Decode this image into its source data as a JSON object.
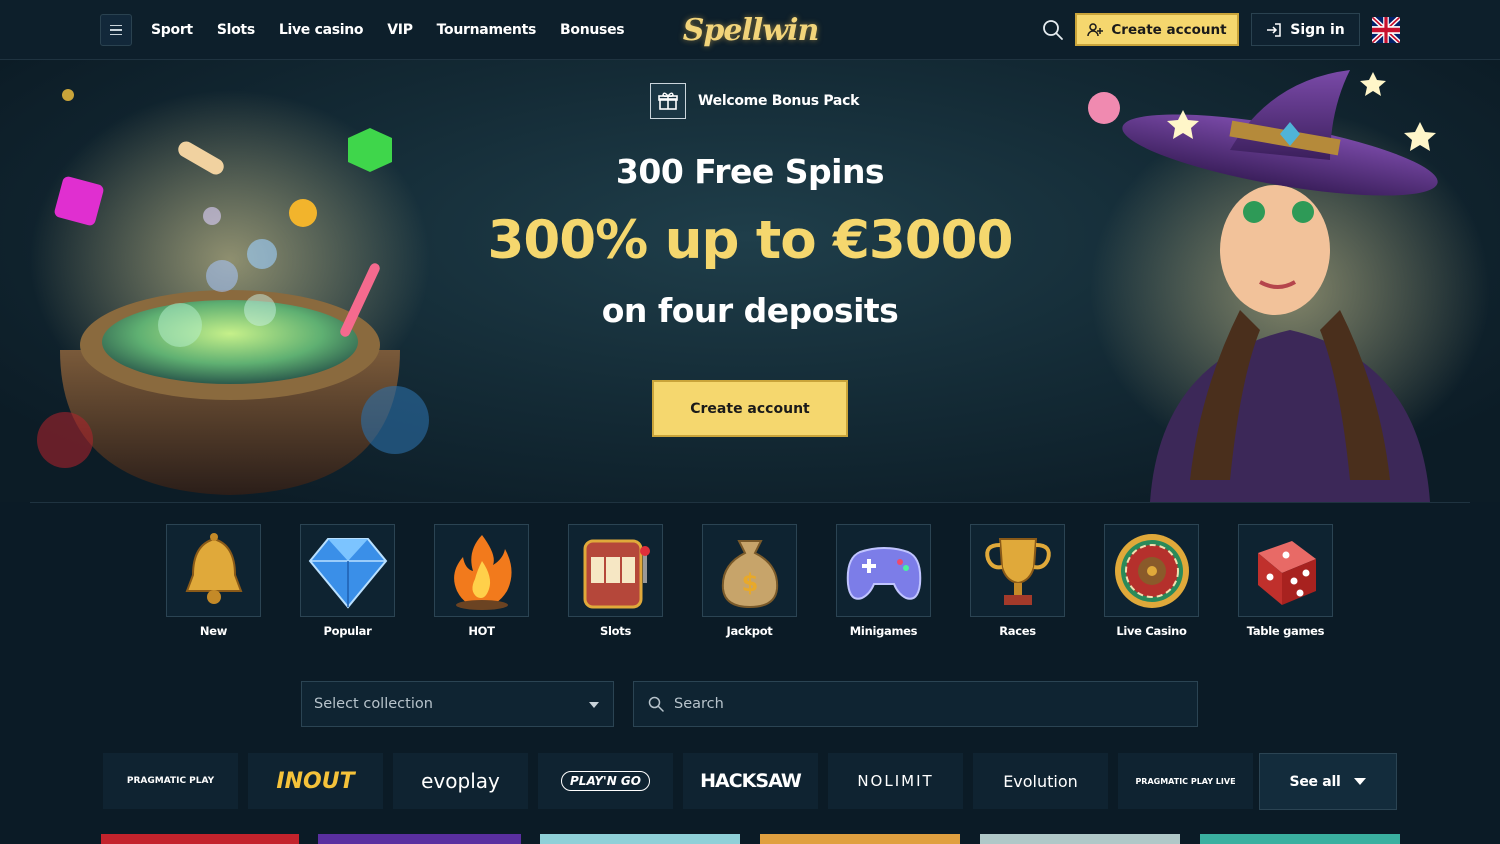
{
  "header": {
    "nav": [
      "Sport",
      "Slots",
      "Live casino",
      "VIP",
      "Tournaments",
      "Bonuses"
    ],
    "logo_text": "Spellwin",
    "create_account_label": "Create account",
    "sign_in_label": "Sign in",
    "language": "en-GB",
    "icons": {
      "menu": "hamburger-menu-icon",
      "search": "search-icon",
      "create": "add-user-icon",
      "signin": "sign-in-icon",
      "flag": "uk-flag-icon"
    }
  },
  "hero": {
    "bonus_label": "Welcome Bonus Pack",
    "line1": "300 Free Spins",
    "line2": "300% up to €3000",
    "line3": "on four deposits",
    "cta_label": "Create account",
    "accent_color": "#f5d76e"
  },
  "categories": [
    {
      "label": "New",
      "icon": "bell-icon"
    },
    {
      "label": "Popular",
      "icon": "diamond-icon"
    },
    {
      "label": "HOT",
      "icon": "fire-icon"
    },
    {
      "label": "Slots",
      "icon": "slot-machine-icon"
    },
    {
      "label": "Jackpot",
      "icon": "money-bag-icon"
    },
    {
      "label": "Minigames",
      "icon": "gamepad-icon"
    },
    {
      "label": "Races",
      "icon": "trophy-icon"
    },
    {
      "label": "Live Casino",
      "icon": "roulette-icon"
    },
    {
      "label": "Table games",
      "icon": "dice-icon"
    }
  ],
  "filters": {
    "collection_placeholder": "Select collection",
    "search_placeholder": "Search"
  },
  "providers": [
    "PRAGMATIC PLAY",
    "INOUT",
    "evoplay",
    "PLAY'N GO",
    "HACKSAW",
    "NOLIMIT",
    "Evolution",
    "PRAGMATIC PLAY LIVE"
  ],
  "see_all_label": "See all"
}
